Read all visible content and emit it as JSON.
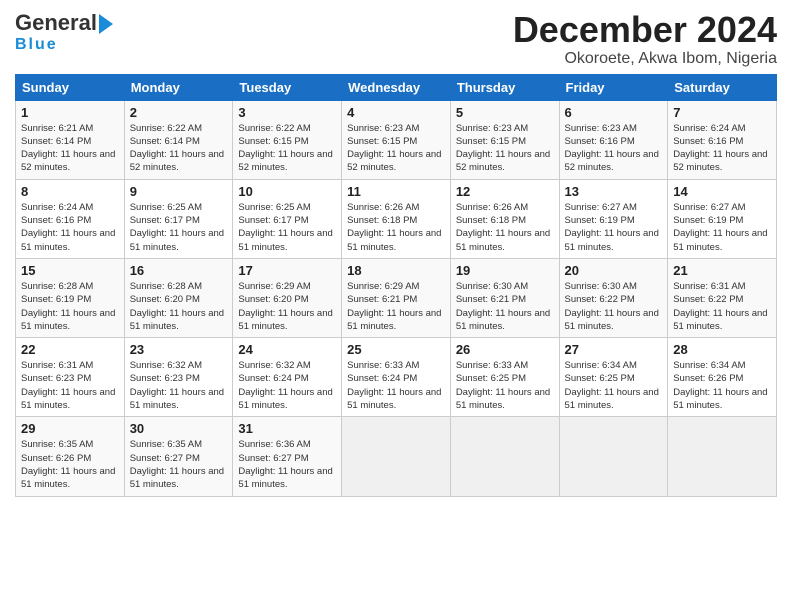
{
  "header": {
    "logo_line1": "General",
    "logo_line2": "Blue",
    "month_title": "December 2024",
    "location": "Okoroete, Akwa Ibom, Nigeria"
  },
  "days_of_week": [
    "Sunday",
    "Monday",
    "Tuesday",
    "Wednesday",
    "Thursday",
    "Friday",
    "Saturday"
  ],
  "weeks": [
    [
      {
        "day": "1",
        "sunrise": "Sunrise: 6:21 AM",
        "sunset": "Sunset: 6:14 PM",
        "daylight": "Daylight: 11 hours and 52 minutes."
      },
      {
        "day": "2",
        "sunrise": "Sunrise: 6:22 AM",
        "sunset": "Sunset: 6:14 PM",
        "daylight": "Daylight: 11 hours and 52 minutes."
      },
      {
        "day": "3",
        "sunrise": "Sunrise: 6:22 AM",
        "sunset": "Sunset: 6:15 PM",
        "daylight": "Daylight: 11 hours and 52 minutes."
      },
      {
        "day": "4",
        "sunrise": "Sunrise: 6:23 AM",
        "sunset": "Sunset: 6:15 PM",
        "daylight": "Daylight: 11 hours and 52 minutes."
      },
      {
        "day": "5",
        "sunrise": "Sunrise: 6:23 AM",
        "sunset": "Sunset: 6:15 PM",
        "daylight": "Daylight: 11 hours and 52 minutes."
      },
      {
        "day": "6",
        "sunrise": "Sunrise: 6:23 AM",
        "sunset": "Sunset: 6:16 PM",
        "daylight": "Daylight: 11 hours and 52 minutes."
      },
      {
        "day": "7",
        "sunrise": "Sunrise: 6:24 AM",
        "sunset": "Sunset: 6:16 PM",
        "daylight": "Daylight: 11 hours and 52 minutes."
      }
    ],
    [
      {
        "day": "8",
        "sunrise": "Sunrise: 6:24 AM",
        "sunset": "Sunset: 6:16 PM",
        "daylight": "Daylight: 11 hours and 51 minutes."
      },
      {
        "day": "9",
        "sunrise": "Sunrise: 6:25 AM",
        "sunset": "Sunset: 6:17 PM",
        "daylight": "Daylight: 11 hours and 51 minutes."
      },
      {
        "day": "10",
        "sunrise": "Sunrise: 6:25 AM",
        "sunset": "Sunset: 6:17 PM",
        "daylight": "Daylight: 11 hours and 51 minutes."
      },
      {
        "day": "11",
        "sunrise": "Sunrise: 6:26 AM",
        "sunset": "Sunset: 6:18 PM",
        "daylight": "Daylight: 11 hours and 51 minutes."
      },
      {
        "day": "12",
        "sunrise": "Sunrise: 6:26 AM",
        "sunset": "Sunset: 6:18 PM",
        "daylight": "Daylight: 11 hours and 51 minutes."
      },
      {
        "day": "13",
        "sunrise": "Sunrise: 6:27 AM",
        "sunset": "Sunset: 6:19 PM",
        "daylight": "Daylight: 11 hours and 51 minutes."
      },
      {
        "day": "14",
        "sunrise": "Sunrise: 6:27 AM",
        "sunset": "Sunset: 6:19 PM",
        "daylight": "Daylight: 11 hours and 51 minutes."
      }
    ],
    [
      {
        "day": "15",
        "sunrise": "Sunrise: 6:28 AM",
        "sunset": "Sunset: 6:19 PM",
        "daylight": "Daylight: 11 hours and 51 minutes."
      },
      {
        "day": "16",
        "sunrise": "Sunrise: 6:28 AM",
        "sunset": "Sunset: 6:20 PM",
        "daylight": "Daylight: 11 hours and 51 minutes."
      },
      {
        "day": "17",
        "sunrise": "Sunrise: 6:29 AM",
        "sunset": "Sunset: 6:20 PM",
        "daylight": "Daylight: 11 hours and 51 minutes."
      },
      {
        "day": "18",
        "sunrise": "Sunrise: 6:29 AM",
        "sunset": "Sunset: 6:21 PM",
        "daylight": "Daylight: 11 hours and 51 minutes."
      },
      {
        "day": "19",
        "sunrise": "Sunrise: 6:30 AM",
        "sunset": "Sunset: 6:21 PM",
        "daylight": "Daylight: 11 hours and 51 minutes."
      },
      {
        "day": "20",
        "sunrise": "Sunrise: 6:30 AM",
        "sunset": "Sunset: 6:22 PM",
        "daylight": "Daylight: 11 hours and 51 minutes."
      },
      {
        "day": "21",
        "sunrise": "Sunrise: 6:31 AM",
        "sunset": "Sunset: 6:22 PM",
        "daylight": "Daylight: 11 hours and 51 minutes."
      }
    ],
    [
      {
        "day": "22",
        "sunrise": "Sunrise: 6:31 AM",
        "sunset": "Sunset: 6:23 PM",
        "daylight": "Daylight: 11 hours and 51 minutes."
      },
      {
        "day": "23",
        "sunrise": "Sunrise: 6:32 AM",
        "sunset": "Sunset: 6:23 PM",
        "daylight": "Daylight: 11 hours and 51 minutes."
      },
      {
        "day": "24",
        "sunrise": "Sunrise: 6:32 AM",
        "sunset": "Sunset: 6:24 PM",
        "daylight": "Daylight: 11 hours and 51 minutes."
      },
      {
        "day": "25",
        "sunrise": "Sunrise: 6:33 AM",
        "sunset": "Sunset: 6:24 PM",
        "daylight": "Daylight: 11 hours and 51 minutes."
      },
      {
        "day": "26",
        "sunrise": "Sunrise: 6:33 AM",
        "sunset": "Sunset: 6:25 PM",
        "daylight": "Daylight: 11 hours and 51 minutes."
      },
      {
        "day": "27",
        "sunrise": "Sunrise: 6:34 AM",
        "sunset": "Sunset: 6:25 PM",
        "daylight": "Daylight: 11 hours and 51 minutes."
      },
      {
        "day": "28",
        "sunrise": "Sunrise: 6:34 AM",
        "sunset": "Sunset: 6:26 PM",
        "daylight": "Daylight: 11 hours and 51 minutes."
      }
    ],
    [
      {
        "day": "29",
        "sunrise": "Sunrise: 6:35 AM",
        "sunset": "Sunset: 6:26 PM",
        "daylight": "Daylight: 11 hours and 51 minutes."
      },
      {
        "day": "30",
        "sunrise": "Sunrise: 6:35 AM",
        "sunset": "Sunset: 6:27 PM",
        "daylight": "Daylight: 11 hours and 51 minutes."
      },
      {
        "day": "31",
        "sunrise": "Sunrise: 6:36 AM",
        "sunset": "Sunset: 6:27 PM",
        "daylight": "Daylight: 11 hours and 51 minutes."
      },
      null,
      null,
      null,
      null
    ]
  ]
}
